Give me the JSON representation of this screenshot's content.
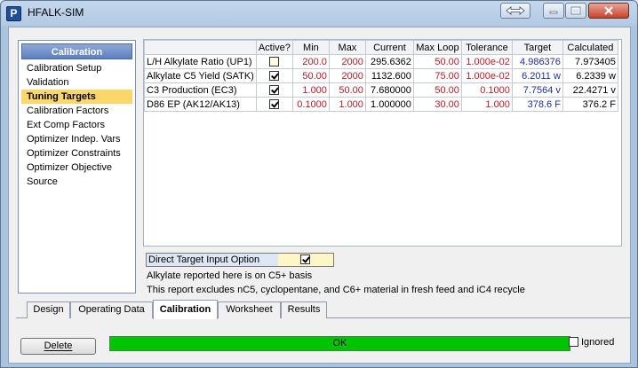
{
  "window": {
    "title": "HFALK-SIM",
    "app_icon_letter": "P"
  },
  "nav": {
    "header": "Calibration",
    "items": [
      "Calibration Setup",
      "Validation",
      "Tuning Targets",
      "Calibration Factors",
      "Ext Comp Factors",
      "Optimizer Indep. Vars",
      "Optimizer Constraints",
      "Optimizer Objective",
      "Source"
    ],
    "selected": "Tuning Targets"
  },
  "grid": {
    "headers": [
      "",
      "Active?",
      "Min",
      "Max",
      "Current",
      "Max Loop",
      "Tolerance",
      "Target",
      "Calculated"
    ],
    "rows": [
      {
        "name": "L/H Alkylate Ratio (UP1)",
        "active": false,
        "min": "200.0",
        "max": "2000",
        "current": "295.6362",
        "max_loop": "50.00",
        "tolerance": "1.000e-02",
        "target": "4.986376",
        "calculated": "7.973405"
      },
      {
        "name": "Alkylate C5 Yield (SATK)",
        "active": true,
        "min": "50.00",
        "max": "2000",
        "current": "1132.600",
        "max_loop": "75.00",
        "tolerance": "1.000e-02",
        "target": "6.2011 w",
        "calculated": "6.2339 w"
      },
      {
        "name": "C3 Production (EC3)",
        "active": true,
        "min": "1.000",
        "max": "50.00",
        "current": "7.680000",
        "max_loop": "50.00",
        "tolerance": "0.1000",
        "target": "7.7564 v",
        "calculated": "22.4271 v"
      },
      {
        "name": "D86 EP (AK12/AK13)",
        "active": true,
        "min": "0.1000",
        "max": "1.000",
        "current": "1.000000",
        "max_loop": "30.00",
        "tolerance": "1.000",
        "target": "378.6 F",
        "calculated": "376.2 F"
      }
    ]
  },
  "direct_target": {
    "label": "Direct Target Input Option",
    "checked": true
  },
  "notes": [
    "Alkylate reported here is on C5+ basis",
    "This report excludes nC5, cyclopentane, and C6+ material in fresh feed and iC4 recycle"
  ],
  "tabs": [
    "Design",
    "Operating Data",
    "Calibration",
    "Worksheet",
    "Results"
  ],
  "active_tab": "Calibration",
  "footer": {
    "delete_label": "Delete",
    "status_text": "OK",
    "ignored_label": "Ignored",
    "ignored_checked": false
  },
  "colors": {
    "status_ok": "#00c400",
    "selected_nav": "#fbd66a",
    "red_value": "#b01f2a",
    "blue_value": "#1d2f9c"
  }
}
